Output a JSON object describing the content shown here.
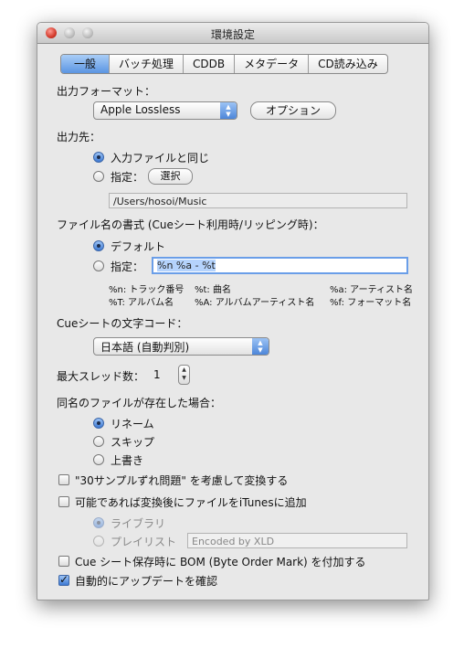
{
  "window": {
    "title": "環境設定"
  },
  "tabs": [
    "一般",
    "バッチ処理",
    "CDDB",
    "メタデータ",
    "CD読み込み"
  ],
  "output_format": {
    "label": "出力フォーマット：",
    "selected": "Apple Lossless",
    "options_button": "オプション"
  },
  "destination": {
    "label": "出力先：",
    "same_as_input": "入力ファイルと同じ",
    "specify": "指定：",
    "choose_button": "選択",
    "path": "/Users/hosoi/Music"
  },
  "filename_format": {
    "label": "ファイル名の書式 (Cueシート利用時/リッピング時)：",
    "default": "デフォルト",
    "specify": "指定：",
    "value": "%n %a - %t",
    "hints": {
      "n": "%n: トラック番号",
      "t": "%t: 曲名",
      "a": "%a: アーティスト名",
      "T": "%T: アルバム名",
      "A": "%A: アルバムアーティスト名",
      "f": "%f: フォーマット名"
    }
  },
  "cue_encoding": {
    "label": "Cueシートの文字コード：",
    "selected": "日本語 (自動判別)"
  },
  "threads": {
    "label": "最大スレッド数：",
    "value": "1"
  },
  "conflict": {
    "label": "同名のファイルが存在した場合：",
    "rename": "リネーム",
    "skip": "スキップ",
    "overwrite": "上書き"
  },
  "options": {
    "sample_offset": "\"30サンプルずれ問題\" を考慮して変換する",
    "add_to_itunes": "可能であれば変換後にファイルをiTunesに追加",
    "library": "ライブラリ",
    "playlist": "プレイリスト",
    "playlist_value": "Encoded by XLD",
    "bom": "Cue シート保存時に BOM (Byte Order Mark) を付加する",
    "auto_update": "自動的にアップデートを確認"
  }
}
